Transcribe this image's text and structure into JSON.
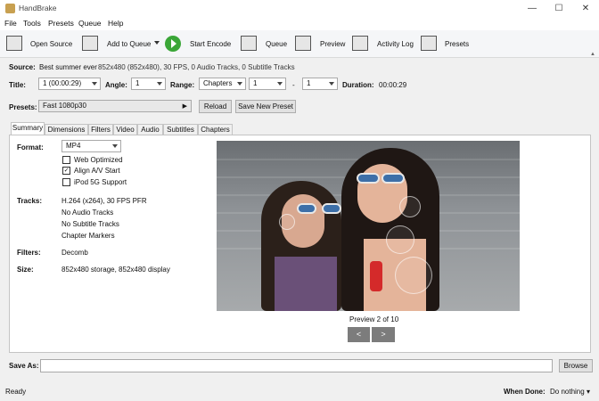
{
  "window": {
    "title": "HandBrake",
    "minimize": "—",
    "maximize": "☐",
    "close": "✕"
  },
  "menu": [
    "File",
    "Tools",
    "Presets",
    "Queue",
    "Help"
  ],
  "toolbar": {
    "open_source": "Open Source",
    "add_to_queue": "Add to Queue",
    "start_encode": "Start Encode",
    "queue": "Queue",
    "preview": "Preview",
    "activity_log": "Activity Log",
    "presets": "Presets"
  },
  "source": {
    "label": "Source:",
    "name": "Best summer ever",
    "details": "852x480 (852x480), 30 FPS, 0 Audio Tracks, 0 Subtitle Tracks"
  },
  "selection": {
    "title_label": "Title:",
    "title_value": "1 (00:00:29)",
    "angle_label": "Angle:",
    "angle_value": "1",
    "range_label": "Range:",
    "range_type": "Chapters",
    "range_start": "1",
    "range_sep": "-",
    "range_end": "1",
    "duration_label": "Duration:",
    "duration_value": "00:00:29"
  },
  "presets": {
    "label": "Presets:",
    "value": "Fast 1080p30",
    "reload": "Reload",
    "save_new": "Save New Preset"
  },
  "tabs": [
    "Summary",
    "Dimensions",
    "Filters",
    "Video",
    "Audio",
    "Subtitles",
    "Chapters"
  ],
  "summary": {
    "format_label": "Format:",
    "format_value": "MP4",
    "web_optimized": {
      "label": "Web Optimized",
      "checked": false
    },
    "align_av": {
      "label": "Align A/V Start",
      "checked": true
    },
    "ipod": {
      "label": "iPod 5G Support",
      "checked": false
    },
    "tracks_label": "Tracks:",
    "tracks": [
      "H.264 (x264), 30 FPS PFR",
      "No Audio Tracks",
      "No Subtitle Tracks",
      "Chapter Markers"
    ],
    "filters_label": "Filters:",
    "filters_value": "Decomb",
    "size_label": "Size:",
    "size_value": "852x480 storage, 852x480 display"
  },
  "preview": {
    "caption": "Preview 2 of 10",
    "prev": "<",
    "next": ">"
  },
  "save_as": {
    "label": "Save As:",
    "value": "",
    "browse": "Browse"
  },
  "status": {
    "text": "Ready",
    "when_done_label": "When Done:",
    "when_done_value": "Do nothing"
  },
  "colors": {
    "start_green": "#3aa637",
    "preview_button": "#7c7c7c"
  }
}
